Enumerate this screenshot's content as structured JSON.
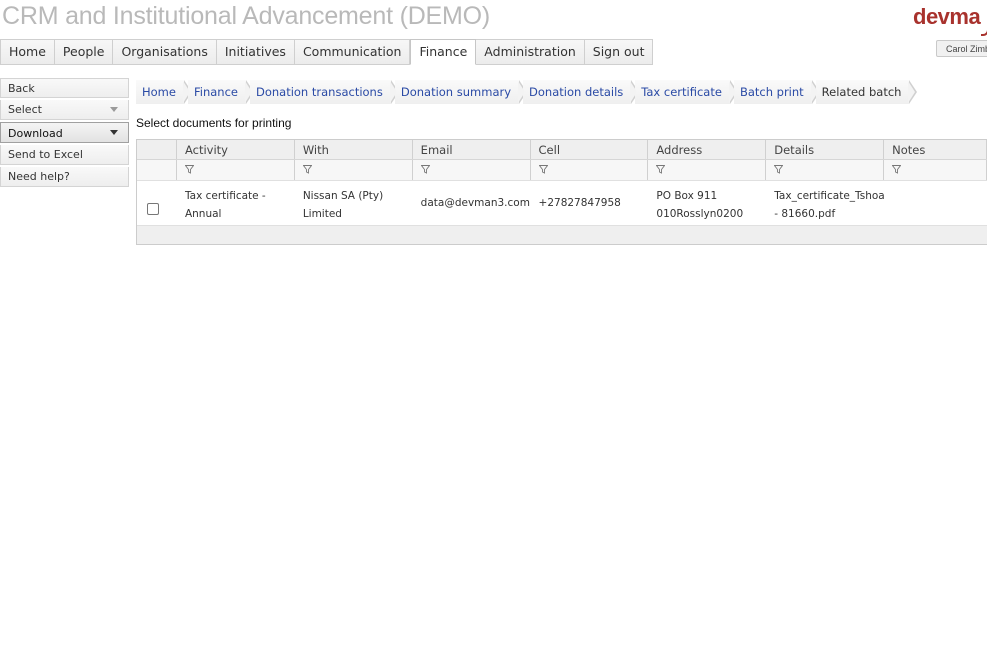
{
  "app": {
    "title": "CRM and Institutional Advancement (DEMO)",
    "brand": "devma",
    "user": "Carol Zimbler"
  },
  "nav": {
    "items": [
      {
        "label": "Home"
      },
      {
        "label": "People"
      },
      {
        "label": "Organisations"
      },
      {
        "label": "Initiatives"
      },
      {
        "label": "Communication"
      },
      {
        "label": "Finance",
        "active": true
      },
      {
        "label": "Administration"
      },
      {
        "label": "Sign out"
      }
    ]
  },
  "sidebar": {
    "items": [
      {
        "label": "Back"
      },
      {
        "label": "Select"
      },
      {
        "label": "Download"
      },
      {
        "label": "Send to Excel"
      },
      {
        "label": "Need help?"
      }
    ]
  },
  "breadcrumb": {
    "items": [
      {
        "label": "Home"
      },
      {
        "label": "Finance"
      },
      {
        "label": "Donation transactions"
      },
      {
        "label": "Donation summary"
      },
      {
        "label": "Donation details"
      },
      {
        "label": "Tax certificate"
      },
      {
        "label": "Batch print"
      },
      {
        "label": "Related batch"
      }
    ]
  },
  "main": {
    "section_title": "Select documents for printing"
  },
  "table": {
    "columns": [
      "Activity",
      "With",
      "Email",
      "Cell",
      "Address",
      "Details",
      "Notes"
    ],
    "rows": [
      {
        "selected": false,
        "activity_line1": "Tax certificate -",
        "activity_line2": "Annual",
        "with_line1": "Nissan SA (Pty)",
        "with_line2": "Limited",
        "email": "data@devman3.com",
        "cell": "+27827847958",
        "address_line1": "PO Box 911",
        "address_line2": "010Rosslyn0200",
        "details_line1": "Tax_certificate_Tshoar",
        "details_line2": "- 81660.pdf",
        "notes": ""
      }
    ]
  },
  "colors": {
    "brand": "#a8322d",
    "title_grey": "#b9b9b9",
    "link_blue": "#2a4aa5"
  },
  "icons": {
    "filter": "funnel-icon",
    "dropdown": "caret-down-icon"
  }
}
